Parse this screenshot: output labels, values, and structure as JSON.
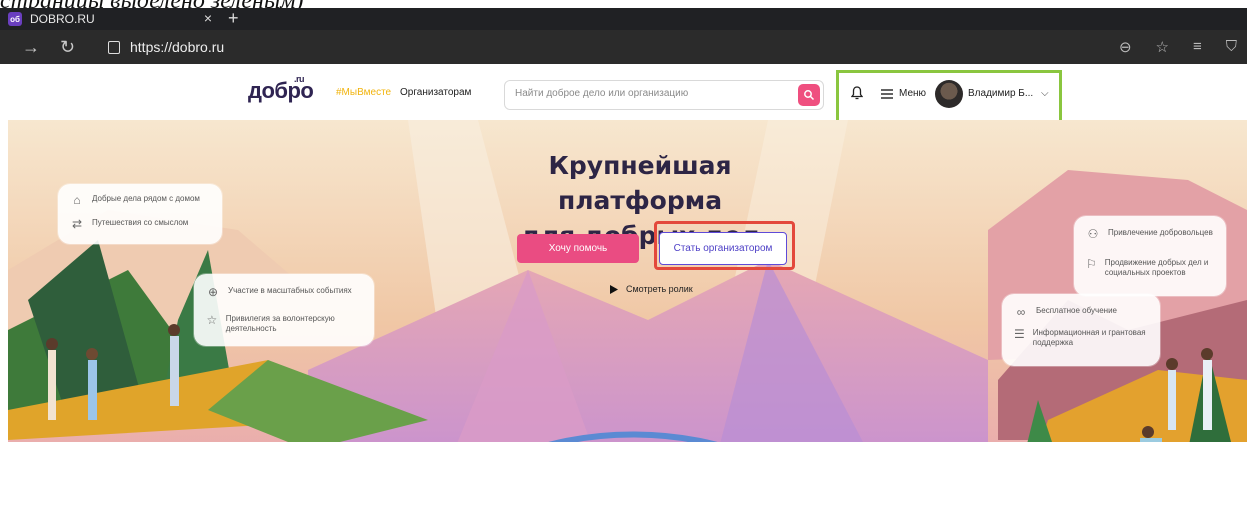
{
  "caption": "страницы выделено зеленым)",
  "browser": {
    "tab_title": "DOBRO.RU",
    "tab_favicon": "об",
    "tab_close": "×",
    "new_tab": "+",
    "url": "https://dobro.ru"
  },
  "header": {
    "logo": "добро",
    "logo_ru": ".ru",
    "hashtag": "#МыВместе",
    "organizers_link": "Организаторам",
    "search_placeholder": "Найти доброе дело или организацию",
    "menu_label": "Меню",
    "user_name": "Владимир Б..."
  },
  "hero": {
    "title_line1": "Крупнейшая платформа",
    "title_line2": "для добрых дел",
    "help_button": "Хочу помочь",
    "organizer_button": "Стать организатором",
    "watch_video": "Смотреть ролик"
  },
  "cards": {
    "left_top": [
      "Добрые дела рядом с домом",
      "Путешествия со смыслом"
    ],
    "left_bottom": [
      "Участие в масштабных событиях",
      "Привилегия за волонтерскую деятельность"
    ],
    "right_top": [
      "Привлечение добровольцев",
      "Продвижение добрых дел и социальных проектов"
    ],
    "right_bottom": [
      "Бесплатное обучение",
      "Информационная и грантовая поддержка"
    ]
  },
  "colors": {
    "accent_pink": "#ea4c82",
    "organizer_purple": "#4d3fc6",
    "highlight_red": "#e3483b",
    "highlight_green": "#8ac63f"
  }
}
